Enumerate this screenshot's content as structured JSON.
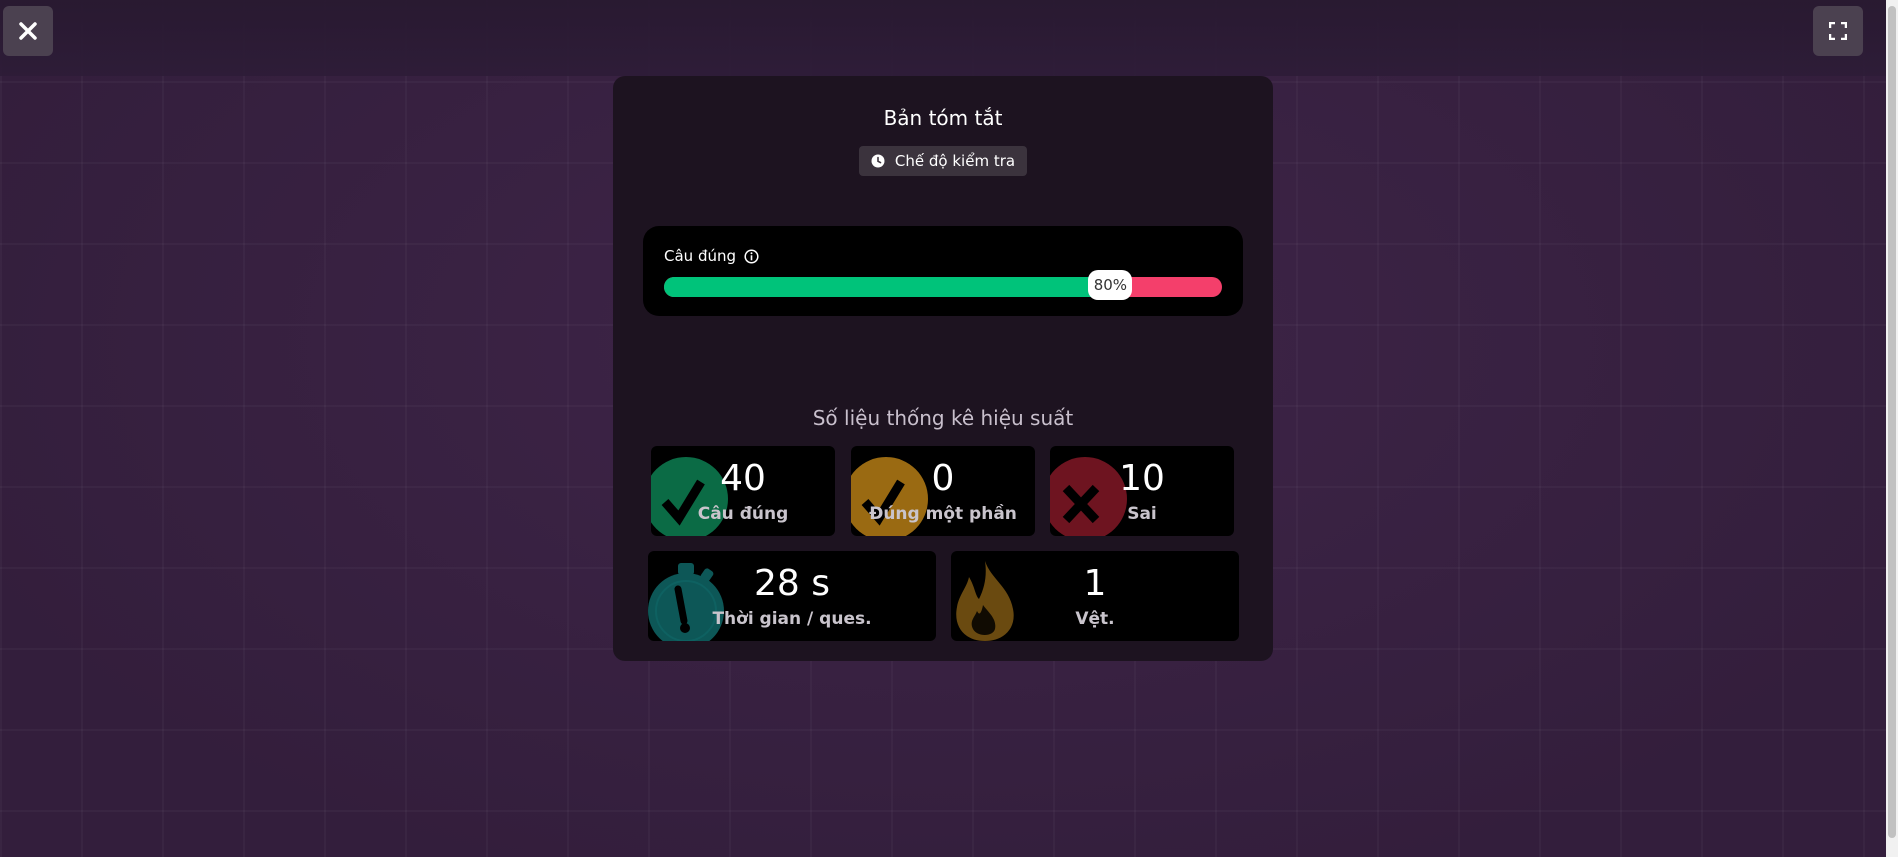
{
  "toolbar": {
    "close_icon": "close-icon",
    "fullscreen_icon": "fullscreen-icon"
  },
  "summary": {
    "title": "Bản tóm tắt",
    "mode_label": "Chế độ kiểm tra",
    "accuracy": {
      "label": "Câu đúng",
      "percent_text": "80%",
      "value": 0.8
    },
    "stats_title": "Số liệu thống kê hiệu suất",
    "stats": {
      "correct": {
        "value": "40",
        "label": "Câu đúng",
        "color": "#0b6b45"
      },
      "partial": {
        "value": "0",
        "label": "Đúng một phần",
        "color": "#9a6a12"
      },
      "wrong": {
        "value": "10",
        "label": "Sai",
        "color": "#6e1420"
      },
      "time": {
        "value": "28 s",
        "label": "Thời gian / ques.",
        "color": "#0d5757"
      },
      "streak": {
        "value": "1",
        "label": "Vệt.",
        "color": "#6a4a10"
      }
    }
  },
  "colors": {
    "correct": "#00c37a",
    "incorrect": "#f43f6b",
    "card": "#1d1320"
  }
}
